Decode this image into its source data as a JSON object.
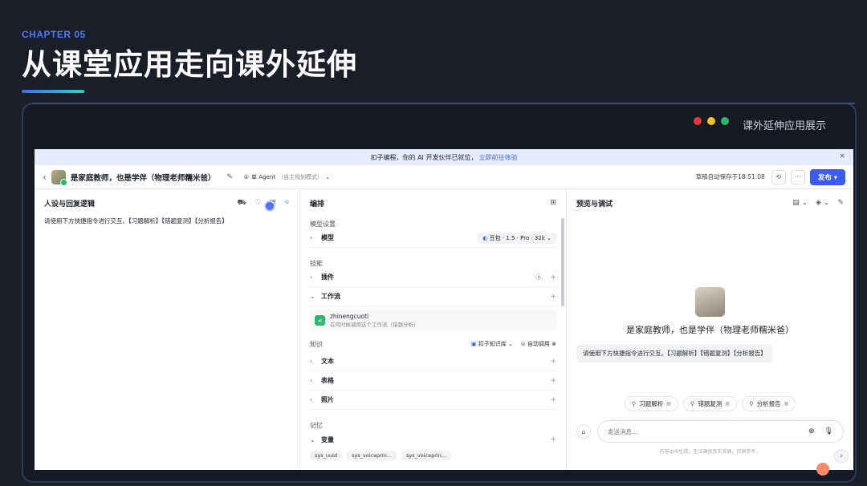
{
  "slide": {
    "chapter": "CHAPTER 05",
    "title": "从课堂应用走向课外延伸",
    "frame_label": "课外延伸应用展示",
    "dot_colors": [
      "#e5383b",
      "#f5c518",
      "#2bb673"
    ]
  },
  "banner": {
    "text": "扣子编程，你的 AI 开发伙伴已就位，",
    "link": "立即前往体验",
    "close": "×"
  },
  "toolbar": {
    "back": "‹",
    "bot_name": "是家庭教师，也是学伴（物理老师糯米爸）",
    "edit": "✎",
    "mode_icon": "①",
    "mode": "单 Agent",
    "mode_sub": "（自主规划模式）",
    "mode_chevron": "⌄",
    "autosave": "草稿自动保存于18:51:08",
    "history_icon": "⟲",
    "more_icon": "···",
    "publish": "发布 ▾"
  },
  "left_pane": {
    "title": "人设与回复逻辑",
    "icons": [
      "⛟",
      "♡",
      "▣",
      "✧"
    ],
    "prompt": "请使用下方快捷指令进行交互。【习题解析】【错题复测】【分析报告】"
  },
  "mid_pane": {
    "title": "编排",
    "layout_icon": "⊞",
    "model_section": "模型设置",
    "model_label": "模型",
    "model_value": "豆包 · 1.5 · Pro · 32k",
    "model_icon": "◐",
    "skills_section": "技能",
    "plugin_label": "插件",
    "workflow_label": "工作流",
    "workflow": {
      "name": "zhinengcuoti",
      "desc": "在何时候调用这个工作流（错题分析）"
    },
    "knowledge_section": "知识",
    "kb_select": "扣子知识库",
    "auto_call": "自动调用",
    "text_label": "文本",
    "table_label": "表格",
    "photo_label": "照片",
    "memory_section": "记忆",
    "variable_label": "变量",
    "variables": [
      "sys_uuid",
      "sys_voiceprin...",
      "sys_voiceprin..."
    ]
  },
  "right_pane": {
    "title": "预览与调试",
    "icons": [
      "▤ ⌄",
      "◈ ⌄",
      "✎"
    ],
    "bot_name": "是家庭教师，也是学伴（物理老师糯米爸）",
    "welcome": "请使用下方快捷指令进行交互。【习题解析】【错题复测】【分析报告】",
    "quick_commands": [
      "习题解析",
      "错题复测",
      "分析报告"
    ],
    "input_placeholder": "发送消息...",
    "disclaimer": "内容由AI生成，无法确保真实准确，仅供参考。",
    "side_arrow": "›"
  }
}
